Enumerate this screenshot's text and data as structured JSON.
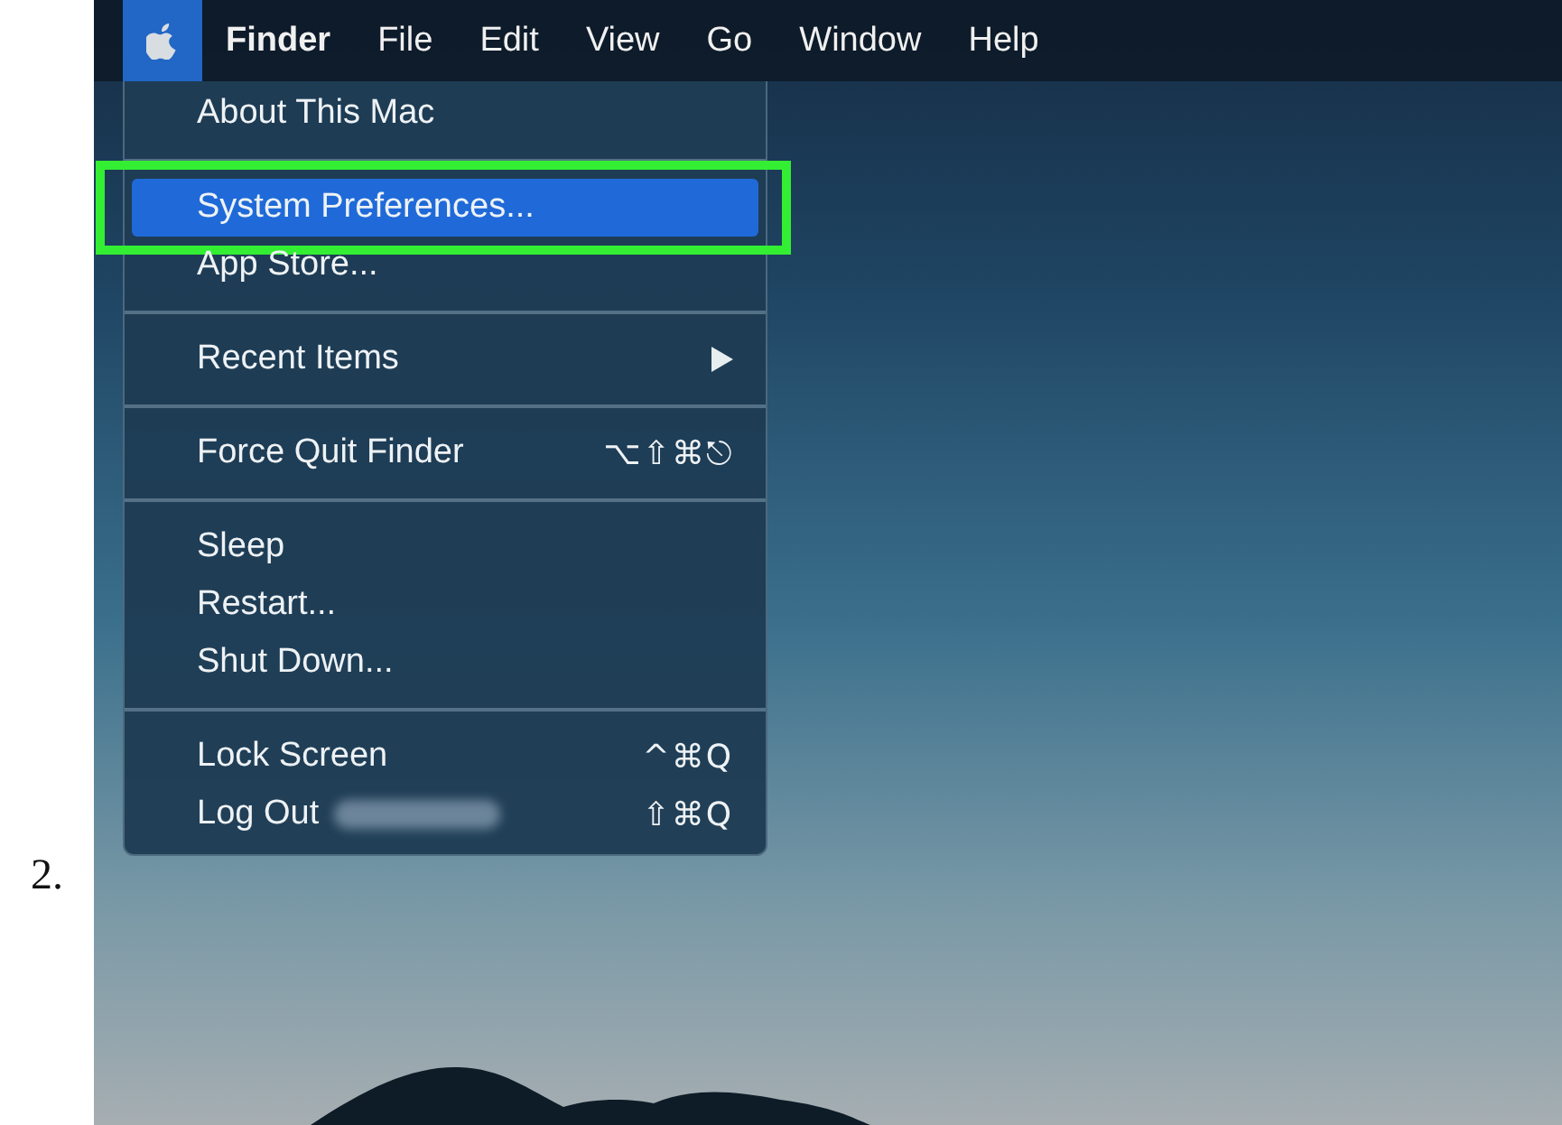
{
  "step_number": "2.",
  "menu_bar": {
    "items": [
      {
        "kind": "apple",
        "selected": true
      },
      {
        "kind": "app",
        "label": "Finder",
        "selected": false
      },
      {
        "kind": "menu",
        "label": "File",
        "selected": false
      },
      {
        "kind": "menu",
        "label": "Edit",
        "selected": false
      },
      {
        "kind": "menu",
        "label": "View",
        "selected": false
      },
      {
        "kind": "menu",
        "label": "Go",
        "selected": false
      },
      {
        "kind": "menu",
        "label": "Window",
        "selected": false
      },
      {
        "kind": "menu",
        "label": "Help",
        "selected": false
      }
    ]
  },
  "apple_menu": {
    "sections": [
      [
        {
          "label": "About This Mac",
          "selected": false,
          "annotated": false,
          "submenu": false,
          "name_redacted": false
        }
      ],
      [
        {
          "label": "System Preferences...",
          "selected": true,
          "annotated": true,
          "submenu": false,
          "name_redacted": false
        },
        {
          "label": "App Store...",
          "selected": false,
          "annotated": false,
          "submenu": false,
          "name_redacted": false
        }
      ],
      [
        {
          "label": "Recent Items",
          "selected": false,
          "annotated": false,
          "submenu": true,
          "name_redacted": false
        }
      ],
      [
        {
          "label": "Force Quit Finder",
          "shortcut": "⌥⇧⌘⎋",
          "selected": false,
          "annotated": false,
          "submenu": false,
          "name_redacted": false
        }
      ],
      [
        {
          "label": "Sleep",
          "selected": false,
          "annotated": false,
          "submenu": false,
          "name_redacted": false
        },
        {
          "label": "Restart...",
          "selected": false,
          "annotated": false,
          "submenu": false,
          "name_redacted": false
        },
        {
          "label": "Shut Down...",
          "selected": false,
          "annotated": false,
          "submenu": false,
          "name_redacted": false
        }
      ],
      [
        {
          "label": "Lock Screen",
          "shortcut": "^⌘Q",
          "selected": false,
          "annotated": false,
          "submenu": false,
          "name_redacted": false
        },
        {
          "label": "Log Out",
          "shortcut": "⇧⌘Q",
          "selected": false,
          "annotated": false,
          "submenu": false,
          "name_redacted": true
        }
      ]
    ]
  }
}
